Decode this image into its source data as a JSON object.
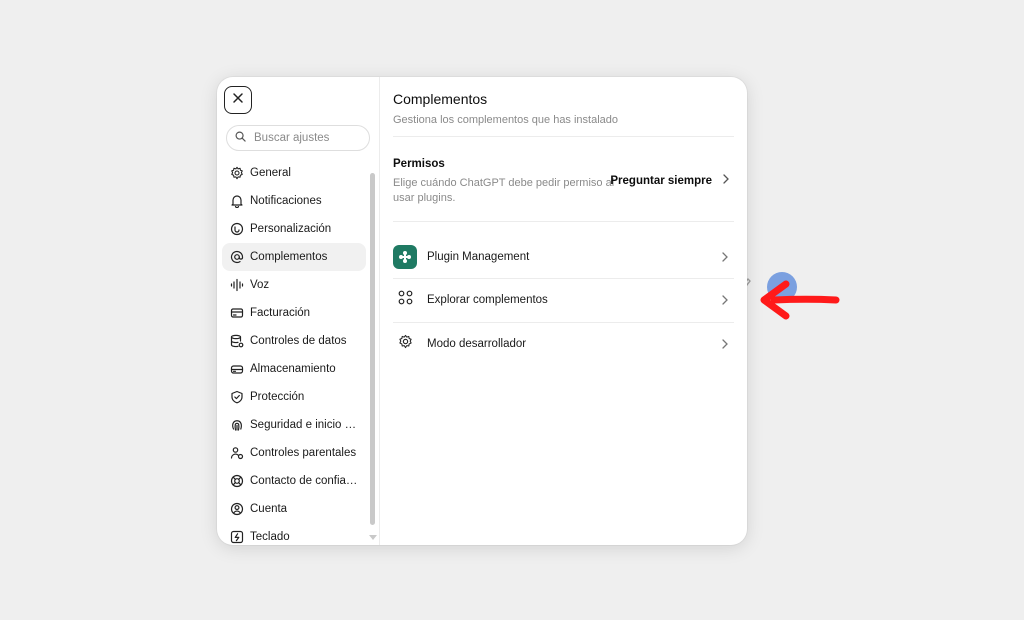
{
  "sidebar": {
    "search_placeholder": "Buscar ajustes",
    "items": [
      {
        "label": "General",
        "icon": "gear-icon",
        "active": false
      },
      {
        "label": "Notificaciones",
        "icon": "bell-icon",
        "active": false
      },
      {
        "label": "Personalización",
        "icon": "personalize-icon",
        "active": false
      },
      {
        "label": "Complementos",
        "icon": "at-icon",
        "active": true
      },
      {
        "label": "Voz",
        "icon": "waveform-icon",
        "active": false
      },
      {
        "label": "Facturación",
        "icon": "card-icon",
        "active": false
      },
      {
        "label": "Controles de datos",
        "icon": "database-icon",
        "active": false
      },
      {
        "label": "Almacenamiento",
        "icon": "storage-icon",
        "active": false
      },
      {
        "label": "Protección",
        "icon": "shield-icon",
        "active": false
      },
      {
        "label": "Seguridad e inicio d...",
        "icon": "fingerprint-icon",
        "active": false
      },
      {
        "label": "Controles parentales",
        "icon": "parental-icon",
        "active": false
      },
      {
        "label": "Contacto de confian...",
        "icon": "lifebuoy-icon",
        "active": false
      },
      {
        "label": "Cuenta",
        "icon": "user-circle-icon",
        "active": false
      },
      {
        "label": "Teclado",
        "icon": "keyboard-icon",
        "active": false
      }
    ]
  },
  "content": {
    "title": "Complementos",
    "subtitle": "Gestiona los complementos que has instalado",
    "permissions": {
      "title": "Permisos",
      "description": "Elige cuándo ChatGPT debe pedir permiso al usar plugins.",
      "action": "Preguntar siempre"
    },
    "rows": [
      {
        "label": "Plugin Management",
        "icon": "plugin-logo-icon"
      },
      {
        "label": "Explorar complementos",
        "icon": "grid-icon"
      },
      {
        "label": "Modo desarrollador",
        "icon": "gear-icon"
      }
    ]
  },
  "colors": {
    "accent": "#1f7a63",
    "arrow": "#ff1a1a",
    "avatar": "#7ba0e0"
  }
}
